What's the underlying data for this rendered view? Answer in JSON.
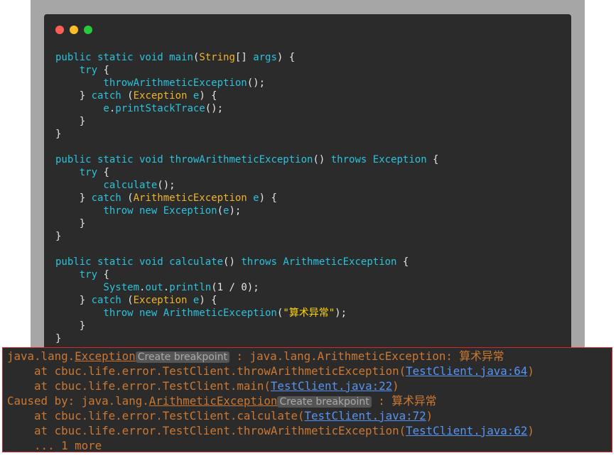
{
  "code_lines": [
    {
      "s": [
        {
          "t": "public static void ",
          "c": "kw"
        },
        {
          "t": "main",
          "c": "fn"
        },
        {
          "t": "(",
          "c": "st"
        },
        {
          "t": "String",
          "c": "ty"
        },
        {
          "t": "[] ",
          "c": "st"
        },
        {
          "t": "args",
          "c": "pa"
        },
        {
          "t": ") {",
          "c": "st"
        }
      ]
    },
    {
      "s": [
        {
          "t": "    try ",
          "c": "kw"
        },
        {
          "t": "{",
          "c": "st"
        }
      ]
    },
    {
      "s": [
        {
          "t": "        throwArithmeticException",
          "c": "fn"
        },
        {
          "t": "();",
          "c": "st"
        }
      ]
    },
    {
      "s": [
        {
          "t": "    } ",
          "c": "st"
        },
        {
          "t": "catch ",
          "c": "kw"
        },
        {
          "t": "(",
          "c": "st"
        },
        {
          "t": "Exception ",
          "c": "ty"
        },
        {
          "t": "e",
          "c": "pa"
        },
        {
          "t": ") {",
          "c": "st"
        }
      ]
    },
    {
      "s": [
        {
          "t": "        e",
          "c": "pa"
        },
        {
          "t": ".",
          "c": "st"
        },
        {
          "t": "printStackTrace",
          "c": "fn"
        },
        {
          "t": "();",
          "c": "st"
        }
      ]
    },
    {
      "s": [
        {
          "t": "    }",
          "c": "st"
        }
      ]
    },
    {
      "s": [
        {
          "t": "}",
          "c": "st"
        }
      ]
    },
    {
      "s": [
        {
          "t": "",
          "c": "st"
        }
      ]
    },
    {
      "s": [
        {
          "t": "public static void ",
          "c": "kw"
        },
        {
          "t": "throwArithmeticException",
          "c": "fn"
        },
        {
          "t": "() ",
          "c": "st"
        },
        {
          "t": "throws ",
          "c": "kw"
        },
        {
          "t": "Exception",
          "c": "fn"
        },
        {
          "t": " {",
          "c": "st"
        }
      ]
    },
    {
      "s": [
        {
          "t": "    try ",
          "c": "kw"
        },
        {
          "t": "{",
          "c": "st"
        }
      ]
    },
    {
      "s": [
        {
          "t": "        calculate",
          "c": "fn"
        },
        {
          "t": "();",
          "c": "st"
        }
      ]
    },
    {
      "s": [
        {
          "t": "    } ",
          "c": "st"
        },
        {
          "t": "catch ",
          "c": "kw"
        },
        {
          "t": "(",
          "c": "st"
        },
        {
          "t": "ArithmeticException ",
          "c": "ty"
        },
        {
          "t": "e",
          "c": "pa"
        },
        {
          "t": ") {",
          "c": "st"
        }
      ]
    },
    {
      "s": [
        {
          "t": "        throw new ",
          "c": "kw"
        },
        {
          "t": "Exception",
          "c": "fn"
        },
        {
          "t": "(",
          "c": "st"
        },
        {
          "t": "e",
          "c": "pa"
        },
        {
          "t": ");",
          "c": "st"
        }
      ]
    },
    {
      "s": [
        {
          "t": "    }",
          "c": "st"
        }
      ]
    },
    {
      "s": [
        {
          "t": "}",
          "c": "st"
        }
      ]
    },
    {
      "s": [
        {
          "t": "",
          "c": "st"
        }
      ]
    },
    {
      "s": [
        {
          "t": "public static void ",
          "c": "kw"
        },
        {
          "t": "calculate",
          "c": "fn"
        },
        {
          "t": "() ",
          "c": "st"
        },
        {
          "t": "throws ",
          "c": "kw"
        },
        {
          "t": "ArithmeticException",
          "c": "fn"
        },
        {
          "t": " {",
          "c": "st"
        }
      ]
    },
    {
      "s": [
        {
          "t": "    try ",
          "c": "kw"
        },
        {
          "t": "{",
          "c": "st"
        }
      ]
    },
    {
      "s": [
        {
          "t": "        System",
          "c": "fn"
        },
        {
          "t": ".",
          "c": "st"
        },
        {
          "t": "out",
          "c": "fn"
        },
        {
          "t": ".",
          "c": "st"
        },
        {
          "t": "println",
          "c": "fn"
        },
        {
          "t": "(",
          "c": "st"
        },
        {
          "t": "1 / 0",
          "c": "st"
        },
        {
          "t": ");",
          "c": "st"
        }
      ]
    },
    {
      "s": [
        {
          "t": "    } ",
          "c": "st"
        },
        {
          "t": "catch ",
          "c": "kw"
        },
        {
          "t": "(",
          "c": "st"
        },
        {
          "t": "Exception ",
          "c": "ty"
        },
        {
          "t": "e",
          "c": "pa"
        },
        {
          "t": ") {",
          "c": "st"
        }
      ]
    },
    {
      "s": [
        {
          "t": "        throw new ",
          "c": "kw"
        },
        {
          "t": "ArithmeticException",
          "c": "fn"
        },
        {
          "t": "(",
          "c": "st"
        },
        {
          "t": "\"算术异常\"",
          "c": "ch"
        },
        {
          "t": ");",
          "c": "st"
        }
      ]
    },
    {
      "s": [
        {
          "t": "    }",
          "c": "st"
        }
      ]
    },
    {
      "s": [
        {
          "t": "}",
          "c": "st"
        }
      ]
    }
  ],
  "console_lines": [
    [
      {
        "t": "java.lang.",
        "c": ""
      },
      {
        "t": "Exception",
        "c": "exc"
      },
      {
        "t": "Create breakpoint",
        "c": "bp"
      },
      {
        "t": " : java.lang.ArithmeticException: 算术异常",
        "c": ""
      }
    ],
    [
      {
        "t": "    at cbuc.life.error.TestClient.throwArithmeticException(",
        "c": ""
      },
      {
        "t": "TestClient.java:64",
        "c": "lnk"
      },
      {
        "t": ")",
        "c": ""
      }
    ],
    [
      {
        "t": "    at cbuc.life.error.TestClient.main(",
        "c": ""
      },
      {
        "t": "TestClient.java:22",
        "c": "lnk"
      },
      {
        "t": ")",
        "c": ""
      }
    ],
    [
      {
        "t": "Caused by: java.lang.",
        "c": ""
      },
      {
        "t": "ArithmeticException",
        "c": "exc"
      },
      {
        "t": "Create breakpoint",
        "c": "bp"
      },
      {
        "t": " : 算术异常",
        "c": ""
      }
    ],
    [
      {
        "t": "    at cbuc.life.error.TestClient.calculate(",
        "c": ""
      },
      {
        "t": "TestClient.java:72",
        "c": "lnk"
      },
      {
        "t": ")",
        "c": ""
      }
    ],
    [
      {
        "t": "    at cbuc.life.error.TestClient.throwArithmeticException(",
        "c": ""
      },
      {
        "t": "TestClient.java:62",
        "c": "lnk"
      },
      {
        "t": ")",
        "c": ""
      }
    ],
    [
      {
        "t": "    ... 1 more",
        "c": ""
      }
    ]
  ],
  "window_dots": [
    {
      "name": "close-dot",
      "color": "#ff5f56"
    },
    {
      "name": "minimize-dot",
      "color": "#ffbd2e"
    },
    {
      "name": "maximize-dot",
      "color": "#27c93f"
    }
  ]
}
